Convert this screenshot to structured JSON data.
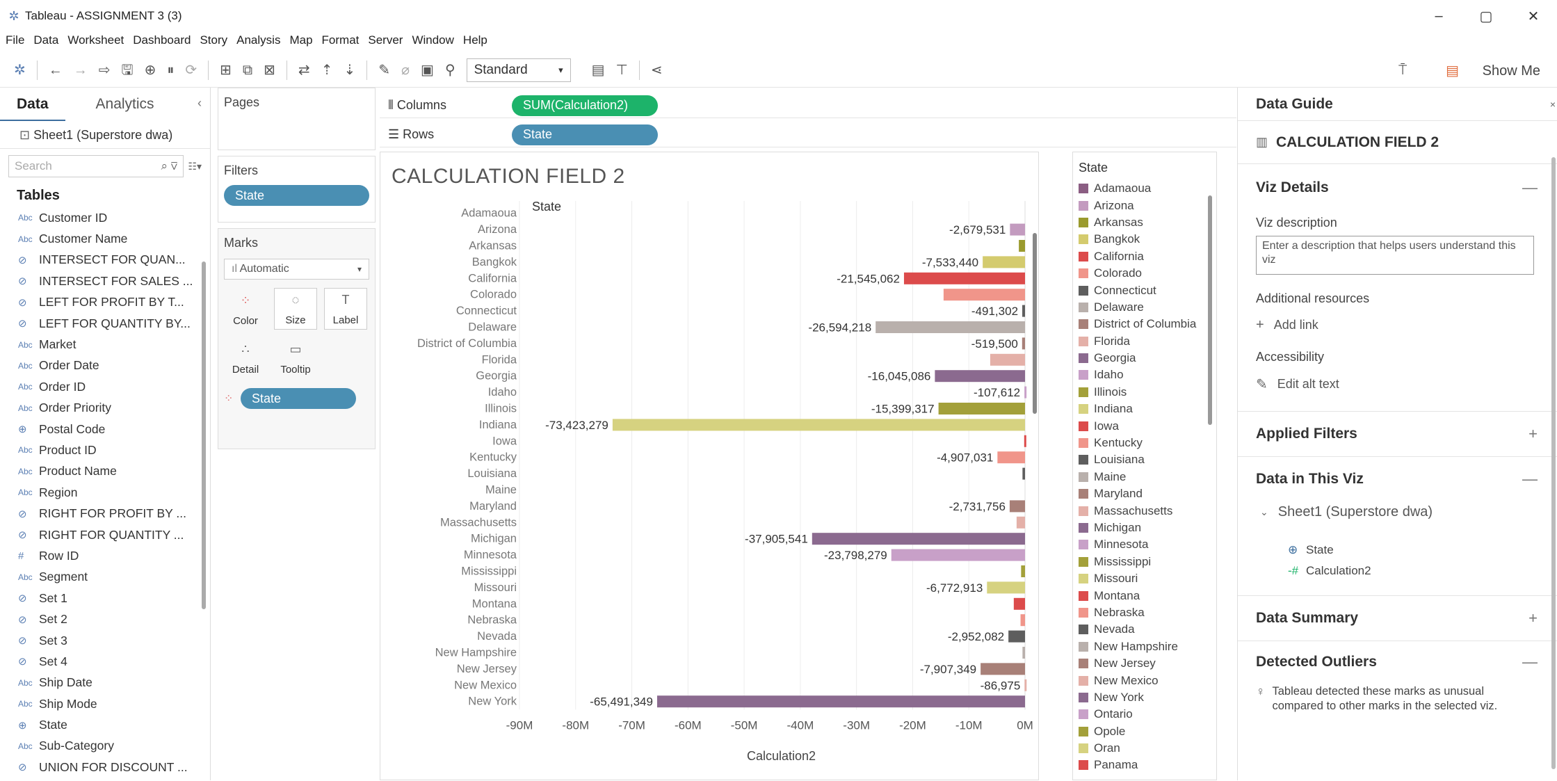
{
  "window": {
    "title": "Tableau - ASSIGNMENT 3 (3)",
    "minimize": "–",
    "maximize": "▢",
    "close": "✕"
  },
  "menu": [
    "File",
    "Data",
    "Worksheet",
    "Dashboard",
    "Story",
    "Analysis",
    "Map",
    "Format",
    "Server",
    "Window",
    "Help"
  ],
  "toolbar": {
    "fit_value": "Standard",
    "show_me": "Show Me"
  },
  "data_pane": {
    "tabs": [
      "Data",
      "Analytics"
    ],
    "source": "Sheet1 (Superstore dwa)",
    "search_placeholder": "Search",
    "tables_header": "Tables",
    "fields": [
      {
        "type": "Abc",
        "name": "Customer ID"
      },
      {
        "type": "Abc",
        "name": "Customer Name"
      },
      {
        "type": "set",
        "name": "INTERSECT FOR QUAN..."
      },
      {
        "type": "set",
        "name": "INTERSECT FOR SALES ..."
      },
      {
        "type": "set",
        "name": "LEFT FOR PROFIT BY T..."
      },
      {
        "type": "set",
        "name": "LEFT FOR QUANTITY BY..."
      },
      {
        "type": "Abc",
        "name": "Market"
      },
      {
        "type": "Abc",
        "name": "Order Date"
      },
      {
        "type": "Abc",
        "name": "Order ID"
      },
      {
        "type": "Abc",
        "name": "Order Priority"
      },
      {
        "type": "geo",
        "name": "Postal Code"
      },
      {
        "type": "Abc",
        "name": "Product ID"
      },
      {
        "type": "Abc",
        "name": "Product Name"
      },
      {
        "type": "Abc",
        "name": "Region"
      },
      {
        "type": "set",
        "name": "RIGHT FOR PROFIT BY ..."
      },
      {
        "type": "set",
        "name": "RIGHT FOR QUANTITY ..."
      },
      {
        "type": "#",
        "name": "Row ID"
      },
      {
        "type": "Abc",
        "name": "Segment"
      },
      {
        "type": "set",
        "name": "Set 1"
      },
      {
        "type": "set",
        "name": "Set 2"
      },
      {
        "type": "set",
        "name": "Set 3"
      },
      {
        "type": "set",
        "name": "Set 4"
      },
      {
        "type": "Abc",
        "name": "Ship Date"
      },
      {
        "type": "Abc",
        "name": "Ship Mode"
      },
      {
        "type": "geo",
        "name": "State"
      },
      {
        "type": "Abc",
        "name": "Sub-Category"
      },
      {
        "type": "set",
        "name": "UNION FOR DISCOUNT ..."
      }
    ]
  },
  "cards": {
    "pages": "Pages",
    "filters": "Filters",
    "filter_pill": "State",
    "marks": "Marks",
    "mark_type": "Automatic",
    "mark_buttons": [
      "Color",
      "Size",
      "Label",
      "Detail",
      "Tooltip"
    ],
    "marks_pill": "State"
  },
  "shelves": {
    "columns_label": "Columns",
    "columns_pill": "SUM(Calculation2)",
    "rows_label": "Rows",
    "rows_pill": "State"
  },
  "chart_data": {
    "type": "bar",
    "title": "CALCULATION FIELD 2",
    "ylabel": "State",
    "xlabel": "Calculation2",
    "xlim": [
      -90000000,
      0
    ],
    "xticks": [
      "-90M",
      "-80M",
      "-70M",
      "-60M",
      "-50M",
      "-40M",
      "-30M",
      "-20M",
      "-10M",
      "0M"
    ],
    "categories": [
      "Adamaoua",
      "Arizona",
      "Arkansas",
      "Bangkok",
      "California",
      "Colorado",
      "Connecticut",
      "Delaware",
      "District of Columbia",
      "Florida",
      "Georgia",
      "Idaho",
      "Illinois",
      "Indiana",
      "Iowa",
      "Kentucky",
      "Louisiana",
      "Maine",
      "Maryland",
      "Massachusetts",
      "Michigan",
      "Minnesota",
      "Mississippi",
      "Missouri",
      "Montana",
      "Nebraska",
      "Nevada",
      "New Hampshire",
      "New Jersey",
      "New Mexico",
      "New York"
    ],
    "values": [
      0,
      -2679531,
      -1100000,
      -7533440,
      -21545062,
      -14500000,
      -491302,
      -26594218,
      -519500,
      -6200000,
      -16045086,
      -107612,
      -15399317,
      -73423279,
      -150000,
      -4907031,
      -450000,
      0,
      -2731756,
      -1500000,
      -37905541,
      -23798279,
      -700000,
      -6772913,
      -2000000,
      -800000,
      -2952082,
      -450000,
      -7907349,
      -86975,
      -65491349
    ],
    "labels": [
      "",
      "-2,679,531",
      "",
      "-7,533,440",
      "-21,545,062",
      "",
      "-491,302",
      "-26,594,218",
      "-519,500",
      "",
      "-16,045,086",
      "-107,612",
      "-15,399,317",
      "-73,423,279",
      "",
      "-4,907,031",
      "",
      "",
      "-2,731,756",
      "",
      "-37,905,541",
      "-23,798,279",
      "",
      "-6,772,913",
      "",
      "",
      "-2,952,082",
      "",
      "-7,907,349",
      "-86,975",
      "-65,491,349"
    ],
    "colors": [
      "#8b5e83",
      "#c39bbf",
      "#9a9a2e",
      "#d4cb6e",
      "#dc4b4b",
      "#f0958a",
      "#5e5e5e",
      "#b9b0ac",
      "#a88078",
      "#e4b0a8",
      "#8b6a8f",
      "#c8a0c8",
      "#a3a03a",
      "#d6d280",
      "#dc4b4b",
      "#f0958a",
      "#5e5e5e",
      "#b9b0ac",
      "#a88078",
      "#e4b0a8",
      "#8b6a8f",
      "#c8a0c8",
      "#a3a03a",
      "#d6d280",
      "#dc4b4b",
      "#f0958a",
      "#5e5e5e",
      "#b9b0ac",
      "#a88078",
      "#e4b0a8",
      "#8b6a8f"
    ]
  },
  "legend": {
    "title": "State",
    "items": [
      {
        "name": "Adamaoua",
        "color": "#8b5e83"
      },
      {
        "name": "Arizona",
        "color": "#c39bbf"
      },
      {
        "name": "Arkansas",
        "color": "#9a9a2e"
      },
      {
        "name": "Bangkok",
        "color": "#d4cb6e"
      },
      {
        "name": "California",
        "color": "#dc4b4b"
      },
      {
        "name": "Colorado",
        "color": "#f0958a"
      },
      {
        "name": "Connecticut",
        "color": "#5e5e5e"
      },
      {
        "name": "Delaware",
        "color": "#b9b0ac"
      },
      {
        "name": "District of Columbia",
        "color": "#a88078"
      },
      {
        "name": "Florida",
        "color": "#e4b0a8"
      },
      {
        "name": "Georgia",
        "color": "#8b6a8f"
      },
      {
        "name": "Idaho",
        "color": "#c8a0c8"
      },
      {
        "name": "Illinois",
        "color": "#a3a03a"
      },
      {
        "name": "Indiana",
        "color": "#d6d280"
      },
      {
        "name": "Iowa",
        "color": "#dc4b4b"
      },
      {
        "name": "Kentucky",
        "color": "#f0958a"
      },
      {
        "name": "Louisiana",
        "color": "#5e5e5e"
      },
      {
        "name": "Maine",
        "color": "#b9b0ac"
      },
      {
        "name": "Maryland",
        "color": "#a88078"
      },
      {
        "name": "Massachusetts",
        "color": "#e4b0a8"
      },
      {
        "name": "Michigan",
        "color": "#8b6a8f"
      },
      {
        "name": "Minnesota",
        "color": "#c8a0c8"
      },
      {
        "name": "Mississippi",
        "color": "#a3a03a"
      },
      {
        "name": "Missouri",
        "color": "#d6d280"
      },
      {
        "name": "Montana",
        "color": "#dc4b4b"
      },
      {
        "name": "Nebraska",
        "color": "#f0958a"
      },
      {
        "name": "Nevada",
        "color": "#5e5e5e"
      },
      {
        "name": "New Hampshire",
        "color": "#b9b0ac"
      },
      {
        "name": "New Jersey",
        "color": "#a88078"
      },
      {
        "name": "New Mexico",
        "color": "#e4b0a8"
      },
      {
        "name": "New York",
        "color": "#8b6a8f"
      },
      {
        "name": "Ontario",
        "color": "#c8a0c8"
      },
      {
        "name": "Opole",
        "color": "#a3a03a"
      },
      {
        "name": "Oran",
        "color": "#d6d280"
      },
      {
        "name": "Panama",
        "color": "#dc4b4b"
      }
    ]
  },
  "guide": {
    "header": "Data Guide",
    "close": "×",
    "sheet_title": "CALCULATION FIELD 2",
    "viz_details": "Viz Details",
    "viz_desc_label": "Viz description",
    "viz_desc_placeholder": "Enter a description that helps users understand this viz",
    "additional_resources": "Additional resources",
    "add_link": "Add link",
    "accessibility": "Accessibility",
    "edit_alt": "Edit alt text",
    "applied_filters": "Applied Filters",
    "data_in_viz": "Data in This Viz",
    "source": "Sheet1 (Superstore dwa)",
    "field1": "State",
    "field2": "Calculation2",
    "data_summary": "Data Summary",
    "detected_outliers": "Detected Outliers",
    "outlier_text": "Tableau detected these marks as unusual compared to other marks in the selected viz."
  }
}
